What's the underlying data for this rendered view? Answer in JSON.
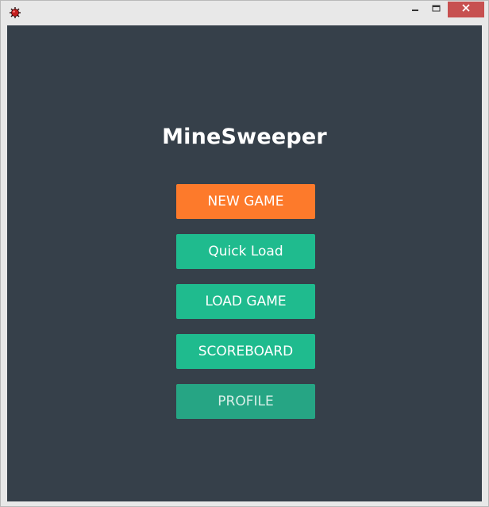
{
  "window": {
    "icons": {
      "app": "mine-icon",
      "minimize": "minimize-icon",
      "maximize": "maximize-icon",
      "close": "close-icon"
    }
  },
  "main": {
    "title": "MineSweeper",
    "buttons": [
      {
        "label": "NEW GAME",
        "color": "#fd7a2b"
      },
      {
        "label": "Quick Load",
        "color": "#1fbb8e"
      },
      {
        "label": "LOAD GAME",
        "color": "#1fbb8e"
      },
      {
        "label": "SCOREBOARD",
        "color": "#1fbb8e"
      },
      {
        "label": "PROFILE",
        "color": "#26a584"
      }
    ]
  },
  "colors": {
    "background": "#36404a",
    "title_text": "#ffffff",
    "close_button": "#c75050"
  }
}
